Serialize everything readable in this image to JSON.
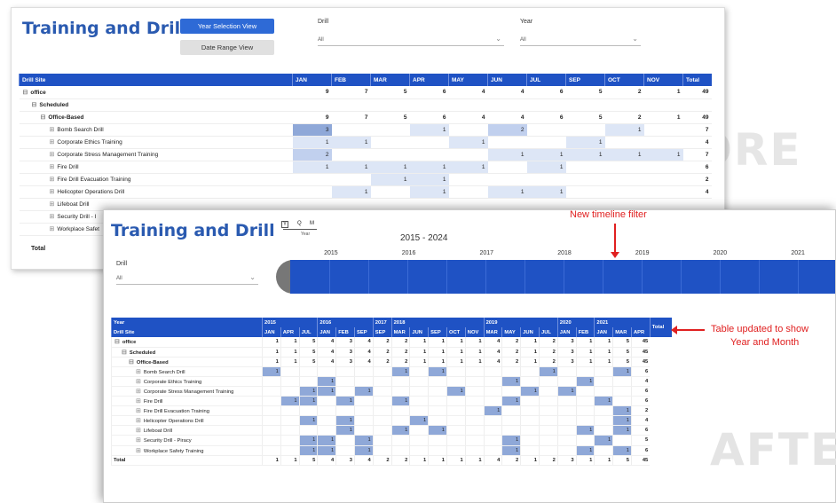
{
  "watermarks": {
    "before": "BEFORE",
    "after": "AFTE"
  },
  "before": {
    "title": "Training and Drill",
    "btn_year": "Year Selection View",
    "btn_range": "Date Range View",
    "drill_label": "Drill",
    "drill_value": "All",
    "year_label": "Year",
    "year_value": "All",
    "columns": [
      "Drill Site",
      "JAN",
      "FEB",
      "MAR",
      "APR",
      "MAY",
      "JUN",
      "JUL",
      "SEP",
      "OCT",
      "NOV",
      "Total"
    ],
    "rows": [
      {
        "indent": 0,
        "bold": true,
        "exp": "⊟",
        "label": "office",
        "cells": [
          "9",
          "7",
          "5",
          "6",
          "4",
          "4",
          "6",
          "5",
          "2",
          "1",
          "49"
        ]
      },
      {
        "indent": 1,
        "bold": true,
        "exp": "⊟",
        "label": "Scheduled",
        "cells": [
          "",
          "",
          "",
          "",
          "",
          "",
          "",
          "",
          "",
          "",
          ""
        ]
      },
      {
        "indent": 2,
        "bold": true,
        "exp": "⊟",
        "label": "Office-Based",
        "cells": [
          "9",
          "7",
          "5",
          "6",
          "4",
          "4",
          "6",
          "5",
          "2",
          "1",
          "49"
        ]
      },
      {
        "indent": 3,
        "bold": false,
        "exp": "⊞",
        "label": "Bomb Search Drill",
        "cells": [
          "3",
          "",
          "",
          "1",
          "",
          "2",
          "",
          "",
          "1",
          "",
          "7"
        ]
      },
      {
        "indent": 3,
        "bold": false,
        "exp": "⊞",
        "label": "Corporate Ethics Training",
        "cells": [
          "1",
          "1",
          "",
          "",
          "1",
          "",
          "",
          "1",
          "",
          "",
          "4"
        ]
      },
      {
        "indent": 3,
        "bold": false,
        "exp": "⊞",
        "label": "Corporate Stress Management Training",
        "cells": [
          "2",
          "",
          "",
          "",
          "",
          "1",
          "1",
          "1",
          "1",
          "1",
          "7"
        ]
      },
      {
        "indent": 3,
        "bold": false,
        "exp": "⊞",
        "label": "Fire Drill",
        "cells": [
          "1",
          "1",
          "1",
          "1",
          "1",
          "",
          "1",
          "",
          "",
          "",
          "6"
        ]
      },
      {
        "indent": 3,
        "bold": false,
        "exp": "⊞",
        "label": "Fire Drill Evacuation Training",
        "cells": [
          "",
          "",
          "1",
          "1",
          "",
          "",
          "",
          "",
          "",
          "",
          "2"
        ]
      },
      {
        "indent": 3,
        "bold": false,
        "exp": "⊞",
        "label": "Helicopter Operations Drill",
        "cells": [
          "",
          "1",
          "",
          "1",
          "",
          "1",
          "1",
          "",
          "",
          "",
          "4"
        ]
      },
      {
        "indent": 3,
        "bold": false,
        "exp": "⊞",
        "label": "Lifeboat Drill",
        "cells": [
          "",
          "",
          "",
          "",
          "",
          "",
          "",
          "",
          "",
          "",
          ""
        ]
      },
      {
        "indent": 3,
        "bold": false,
        "exp": "⊞",
        "label": "Security Drill - I",
        "cells": [
          "",
          "",
          "",
          "",
          "",
          "",
          "",
          "",
          "",
          "",
          ""
        ]
      },
      {
        "indent": 3,
        "bold": false,
        "exp": "⊞",
        "label": "Workplace Safet",
        "cells": [
          "",
          "",
          "",
          "",
          "",
          "",
          "",
          "",
          "",
          "",
          ""
        ]
      }
    ],
    "total_label": "Total"
  },
  "after": {
    "title": "Training and Drill",
    "slicer": {
      "y": "Y",
      "q": "Q",
      "m": "M",
      "caption": "Year"
    },
    "range": "2015 - 2024",
    "years": [
      "2015",
      "2016",
      "2017",
      "2018",
      "2019",
      "2020",
      "2021"
    ],
    "drill_label": "Drill",
    "drill_value": "All",
    "year_header": "Year",
    "site_header": "Drill Site",
    "total_header": "Total",
    "year_groups": [
      {
        "y": "2015",
        "span": 3
      },
      {
        "y": "2016",
        "span": 3
      },
      {
        "y": "2017",
        "span": 1
      },
      {
        "y": "2018",
        "span": 5
      },
      {
        "y": "2019",
        "span": 4
      },
      {
        "y": "2020",
        "span": 2
      },
      {
        "y": "2021",
        "span": 3
      }
    ],
    "months": [
      "JAN",
      "APR",
      "JUL",
      "JAN",
      "FEB",
      "SEP",
      "SEP",
      "MAR",
      "JUN",
      "SEP",
      "OCT",
      "NOV",
      "MAR",
      "MAY",
      "JUN",
      "JUL",
      "JAN",
      "FEB",
      "JAN",
      "MAR",
      "APR"
    ],
    "rows": [
      {
        "indent": 0,
        "bold": true,
        "exp": "⊟",
        "label": "office",
        "cells": [
          "1",
          "1",
          "5",
          "4",
          "3",
          "4",
          "2",
          "2",
          "1",
          "1",
          "1",
          "1",
          "4",
          "2",
          "1",
          "2",
          "3",
          "1",
          "1",
          "5",
          "45"
        ]
      },
      {
        "indent": 1,
        "bold": true,
        "exp": "⊟",
        "label": "Scheduled",
        "cells": [
          "1",
          "1",
          "5",
          "4",
          "3",
          "4",
          "2",
          "2",
          "1",
          "1",
          "1",
          "1",
          "4",
          "2",
          "1",
          "2",
          "3",
          "1",
          "1",
          "5",
          "45"
        ]
      },
      {
        "indent": 2,
        "bold": true,
        "exp": "⊟",
        "label": "Office-Based",
        "cells": [
          "1",
          "1",
          "5",
          "4",
          "3",
          "4",
          "2",
          "2",
          "1",
          "1",
          "1",
          "1",
          "4",
          "2",
          "1",
          "2",
          "3",
          "1",
          "1",
          "5",
          "45"
        ]
      },
      {
        "indent": 3,
        "bold": false,
        "exp": "⊞",
        "label": "Bomb Search Drill",
        "cells": [
          "1",
          "",
          "",
          "",
          "",
          "",
          "",
          "1",
          "",
          "1",
          "",
          "",
          "",
          "",
          "",
          "1",
          "",
          "",
          "",
          "1",
          "6"
        ]
      },
      {
        "indent": 3,
        "bold": false,
        "exp": "⊞",
        "label": "Corporate Ethics Training",
        "cells": [
          "",
          "",
          "",
          "1",
          "",
          "",
          "",
          "",
          "",
          "",
          "",
          "",
          "",
          "1",
          "",
          "",
          "",
          "1",
          "",
          "",
          "4"
        ]
      },
      {
        "indent": 3,
        "bold": false,
        "exp": "⊞",
        "label": "Corporate Stress Management Training",
        "cells": [
          "",
          "",
          "1",
          "1",
          "",
          "1",
          "",
          "",
          "",
          "",
          "1",
          "",
          "",
          "",
          "1",
          "",
          "1",
          "",
          "",
          "",
          "6"
        ]
      },
      {
        "indent": 3,
        "bold": false,
        "exp": "⊞",
        "label": "Fire Drill",
        "cells": [
          "",
          "1",
          "1",
          "",
          "1",
          "",
          "",
          "1",
          "",
          "",
          "",
          "",
          "",
          "1",
          "",
          "",
          "",
          "",
          "1",
          "",
          "6"
        ]
      },
      {
        "indent": 3,
        "bold": false,
        "exp": "⊞",
        "label": "Fire Drill Evacuation Training",
        "cells": [
          "",
          "",
          "",
          "",
          "",
          "",
          "",
          "",
          "",
          "",
          "",
          "",
          "1",
          "",
          "",
          "",
          "",
          "",
          "",
          "1",
          "2"
        ]
      },
      {
        "indent": 3,
        "bold": false,
        "exp": "⊞",
        "label": "Helicopter Operations Drill",
        "cells": [
          "",
          "",
          "1",
          "",
          "1",
          "",
          "",
          "",
          "1",
          "",
          "",
          "",
          "",
          "",
          "",
          "",
          "",
          "",
          "",
          "1",
          "4"
        ]
      },
      {
        "indent": 3,
        "bold": false,
        "exp": "⊞",
        "label": "Lifeboat Drill",
        "cells": [
          "",
          "",
          "",
          "",
          "1",
          "",
          "",
          "1",
          "",
          "1",
          "",
          "",
          "",
          "",
          "",
          "",
          "",
          "1",
          "",
          "1",
          "6"
        ]
      },
      {
        "indent": 3,
        "bold": false,
        "exp": "⊞",
        "label": "Security Drill - Piracy",
        "cells": [
          "",
          "",
          "1",
          "1",
          "",
          "1",
          "",
          "",
          "",
          "",
          "",
          "",
          "",
          "1",
          "",
          "",
          "",
          "",
          "1",
          "",
          "5"
        ]
      },
      {
        "indent": 3,
        "bold": false,
        "exp": "⊞",
        "label": "Workplace Safety Training",
        "cells": [
          "",
          "",
          "1",
          "1",
          "",
          "1",
          "",
          "",
          "",
          "",
          "",
          "",
          "",
          "1",
          "",
          "",
          "",
          "1",
          "",
          "1",
          "6"
        ]
      }
    ],
    "total_label": "Total",
    "total_cells": [
      "1",
      "1",
      "5",
      "4",
      "3",
      "4",
      "2",
      "2",
      "1",
      "1",
      "1",
      "1",
      "4",
      "2",
      "1",
      "2",
      "3",
      "1",
      "1",
      "5",
      "45"
    ]
  },
  "annotations": {
    "timeline": "New timeline filter",
    "table_line1": "Table updated to show",
    "table_line2": "Year and Month"
  },
  "colors": {
    "header": "#1f52c4",
    "accent": "#2a5ab0",
    "annotation": "#e02020"
  }
}
